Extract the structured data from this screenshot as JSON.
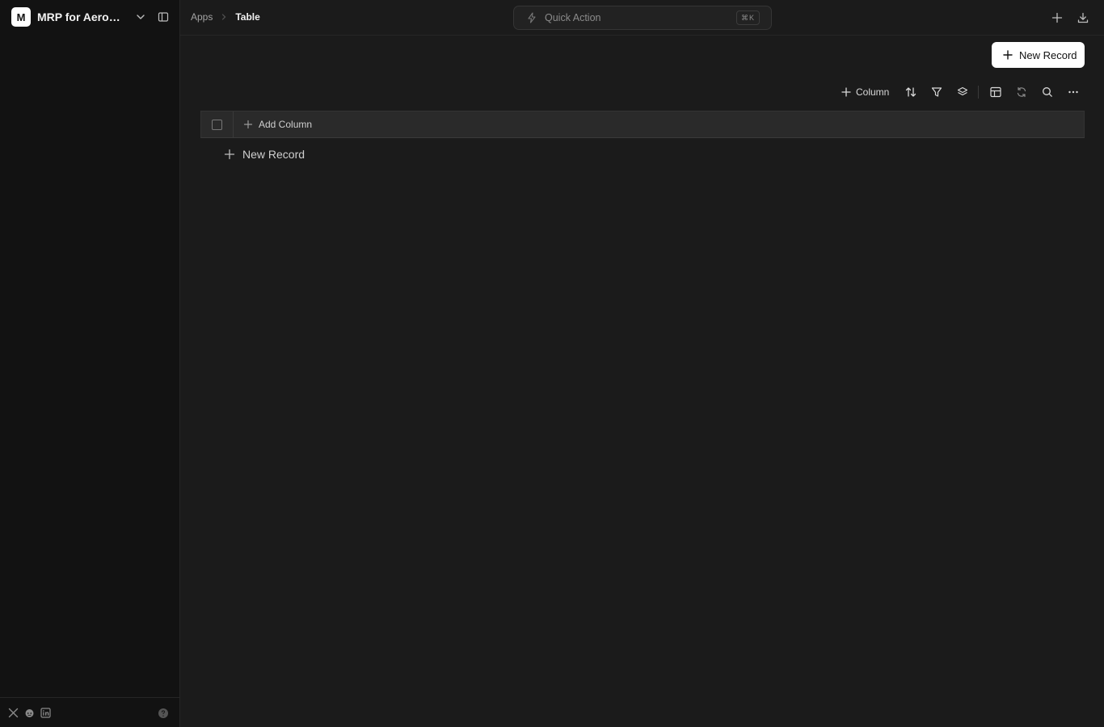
{
  "workspace": {
    "avatar_letter": "M",
    "name": "MRP for Aerosp..."
  },
  "breadcrumb": {
    "parent": "Apps",
    "current": "Table"
  },
  "quick_action": {
    "label": "Quick Action",
    "shortcut": "⌘K"
  },
  "main": {
    "new_record_button": "New Record",
    "toolbar": {
      "column_label": "Column",
      "icons": [
        "sort-icon",
        "filter-icon",
        "layers-icon",
        "table-layout-icon",
        "refresh-icon",
        "search-icon",
        "more-icon"
      ]
    },
    "grid": {
      "add_column_label": "Add Column",
      "new_record_row_label": "New Record"
    }
  },
  "footer": {
    "socials": [
      "x-icon",
      "reddit-icon",
      "linkedin-icon"
    ],
    "help": "help-icon"
  },
  "colors": {
    "background": "#1b1b1b",
    "sidebar": "#121212",
    "accent_button": "#ffffff",
    "grid_header": "#2a2a2a"
  }
}
